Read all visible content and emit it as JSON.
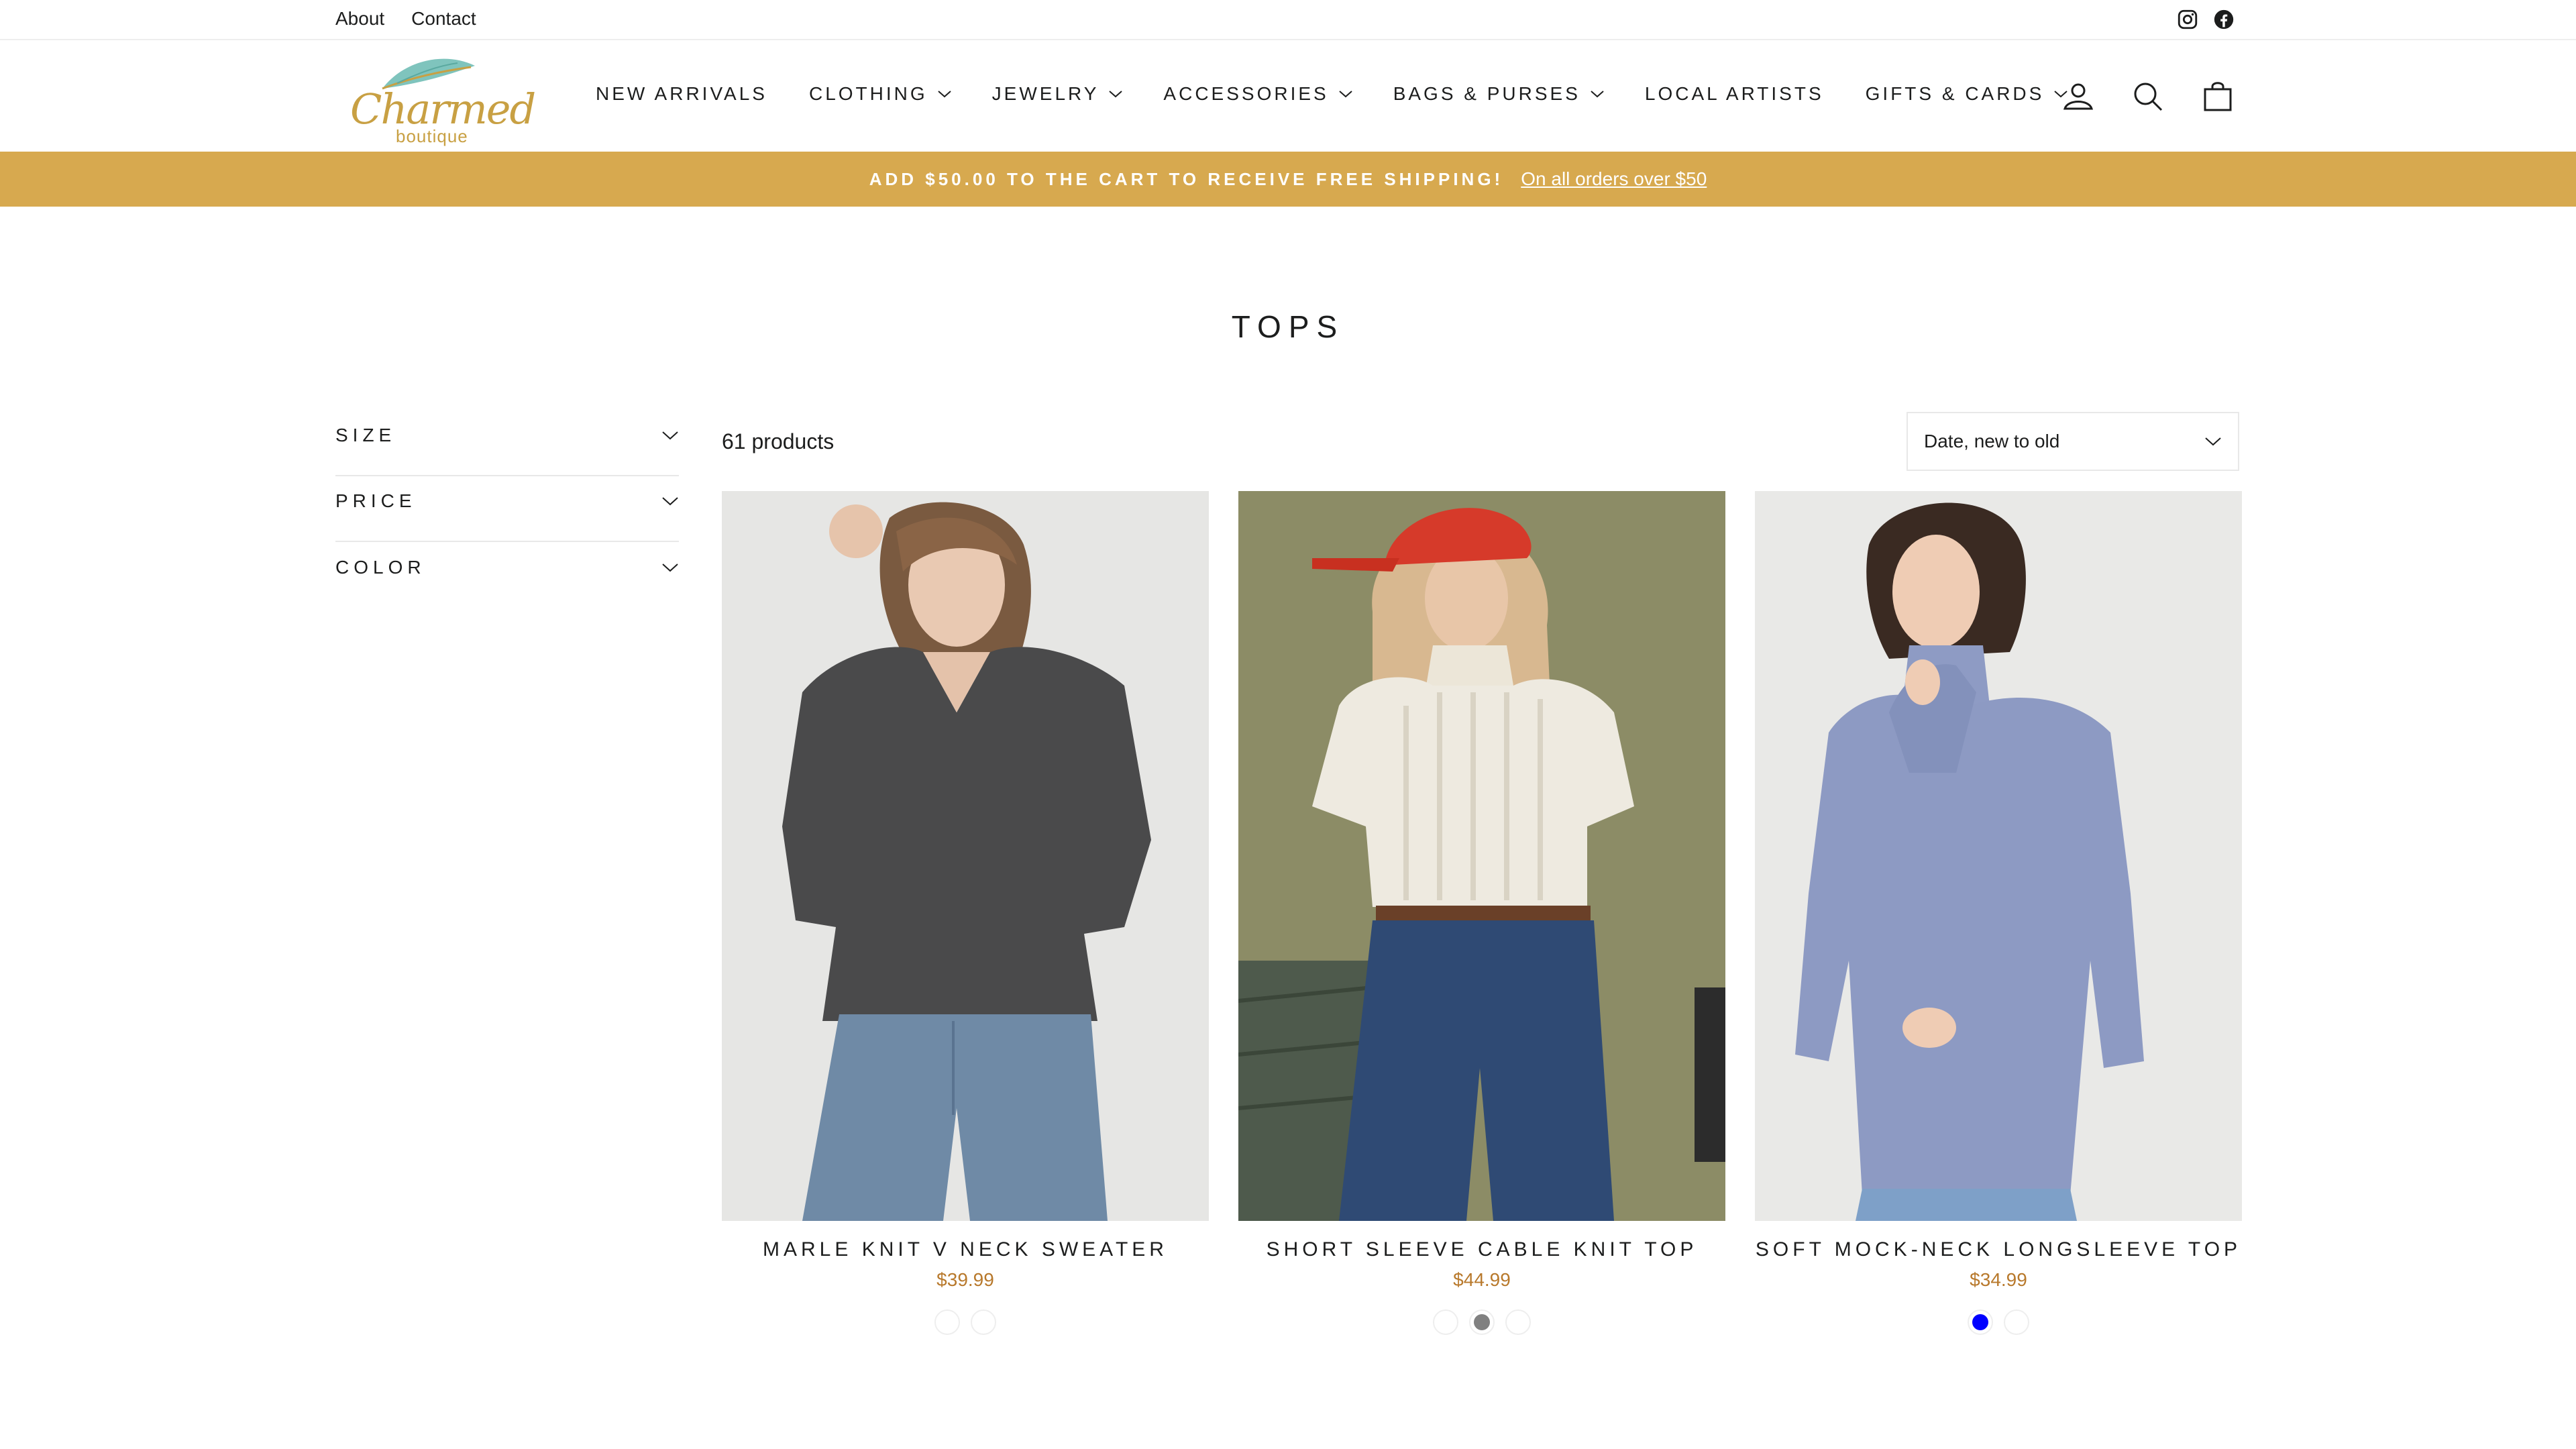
{
  "utility": {
    "links": [
      {
        "label": "About"
      },
      {
        "label": "Contact"
      }
    ],
    "social_icons": [
      "instagram-icon",
      "facebook-icon"
    ]
  },
  "logo": {
    "script": "Charmed",
    "sub": "boutique"
  },
  "nav": {
    "items": [
      {
        "label": "NEW ARRIVALS",
        "dropdown": false
      },
      {
        "label": "CLOTHING",
        "dropdown": true
      },
      {
        "label": "JEWELRY",
        "dropdown": true
      },
      {
        "label": "ACCESSORIES",
        "dropdown": true
      },
      {
        "label": "BAGS & PURSES",
        "dropdown": true
      },
      {
        "label": "LOCAL ARTISTS",
        "dropdown": false
      },
      {
        "label": "GIFTS & CARDS",
        "dropdown": true
      }
    ],
    "icons": [
      "account-icon",
      "search-icon",
      "cart-icon"
    ]
  },
  "announcement": {
    "message": "ADD $50.00 TO THE CART TO RECEIVE FREE SHIPPING!",
    "link": "On all orders over $50",
    "background": "#d7a94f"
  },
  "page": {
    "title": "TOPS"
  },
  "filters": [
    {
      "label": "SIZE"
    },
    {
      "label": "PRICE"
    },
    {
      "label": "COLOR"
    }
  ],
  "toolbar": {
    "count": "61 products",
    "sort": "Date, new to old"
  },
  "products": [
    {
      "name": "MARLE KNIT V NECK SWEATER",
      "price": "$39.99",
      "swatches": [
        "#ffffff",
        "#ffffff"
      ]
    },
    {
      "name": "SHORT SLEEVE CABLE KNIT TOP",
      "price": "$44.99",
      "swatches": [
        "#ffffff",
        "#808080",
        "#ffffff"
      ]
    },
    {
      "name": "SOFT MOCK-NECK LONGSLEEVE TOP",
      "price": "$34.99",
      "swatches": [
        "#0000ff",
        "#ffffff"
      ]
    }
  ],
  "colors": {
    "accent": "#d7a94f",
    "price": "#b8792c",
    "text": "#1c1d1d"
  }
}
